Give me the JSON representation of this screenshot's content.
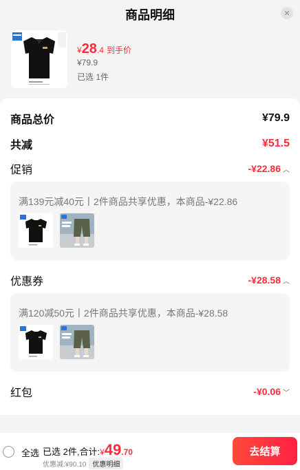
{
  "header": {
    "title": "商品明细",
    "close_icon": "close-icon"
  },
  "product": {
    "price_symbol": "¥",
    "price_int": "28",
    "price_dec": ".4",
    "price_tag": "到手价",
    "original_price": "¥79.9",
    "selected_count": "已选 1件"
  },
  "breakdown": {
    "total_label": "商品总价",
    "total_value": "¥79.9",
    "reduce_label": "共减",
    "reduce_value": "¥51.5",
    "promo_label": "促销",
    "promo_value": "-¥22.86",
    "promo_desc": "满139元减40元丨2件商品共享优惠，本商品-¥22.86",
    "coupon_label": "优惠券",
    "coupon_value": "-¥28.58",
    "coupon_desc": "满120减50元丨2件商品共享优惠，本商品-¥28.58",
    "redpacket_label": "红包",
    "redpacket_value": "-¥0.06"
  },
  "bottom_bar": {
    "select_all": "全选",
    "summary_prefix": "已选 2件,合计:",
    "total_symbol": "¥",
    "total_int": "49",
    "total_dec": ".70",
    "discount_text": "优惠减:¥90.10",
    "detail_label": "优惠明细",
    "checkout_label": "去结算"
  },
  "colors": {
    "accent": "#ff2a3a",
    "checkout_start": "#ff4a3d",
    "checkout_end": "#ff2140",
    "background": "#f4f4f4"
  }
}
